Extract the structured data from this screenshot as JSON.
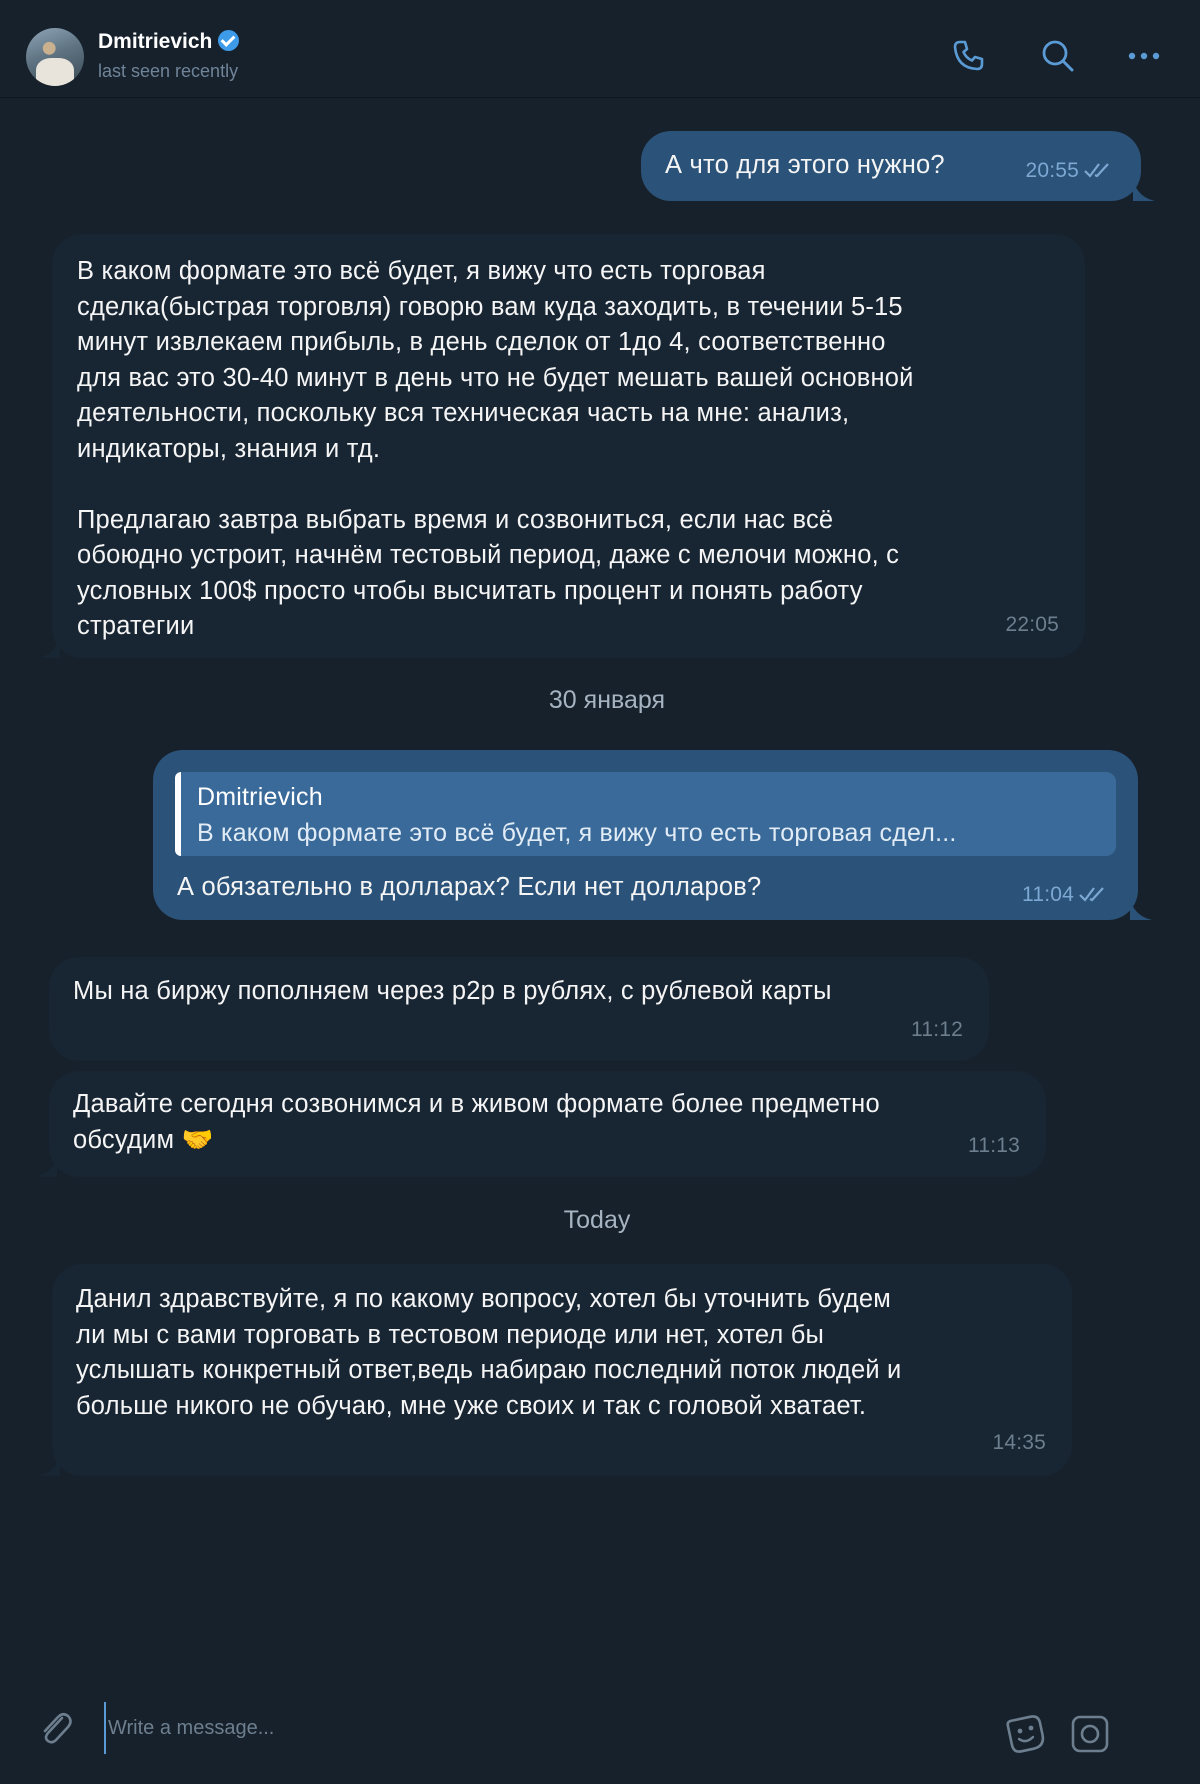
{
  "header": {
    "name": "Dmitrievich",
    "status": "last seen recently",
    "icons": [
      "phone-icon",
      "search-icon",
      "more-icon"
    ]
  },
  "messages": [
    {
      "text": "А что для этого нужно?",
      "time": "20:55"
    },
    {
      "text": "В каком формате это всё будет, я вижу что есть торговая\nсделка(быстрая торговля) говорю вам куда заходить, в течении 5-15\nминут извлекаем прибыль, в день сделок от 1до 4, соответственно\nдля вас это 30-40 минут в день что не будет мешать вашей основной\nдеятельности, поскольку вся техническая часть на мне: анализ,\nиндикаторы, знания и тд.\n\nПредлагаю завтра выбрать время и созвониться, если нас всё\nобоюдно устроит, начнём тестовый период, даже с мелочи можно, с\nусловных 100$ просто чтобы высчитать процент и понять работу\nстратегии",
      "time": "22:05"
    },
    {
      "reply_author": "Dmitrievich",
      "reply_text": "В каком формате это всё будет, я вижу что есть торговая сдел...",
      "text": "А обязательно в долларах? Если нет долларов?",
      "time": "11:04"
    },
    {
      "text": "Мы на биржу пополняем через p2p в рублях, с рублевой карты",
      "time": "11:12"
    },
    {
      "text": "Давайте сегодня созвонимся и в живом формате более предметно\nобсудим 🤝",
      "time": "11:13"
    },
    {
      "text": "Данил здравствуйте, я по какому вопросу, хотел бы уточнить будем\nли мы с вами торговать в тестовом периоде или нет, хотел бы\nуслышать конкретный ответ,ведь набираю последний поток людей и\nбольше никого не обучаю, мне уже своих и так с головой хватает.",
      "time": "14:35"
    }
  ],
  "date_separators": [
    "30 января",
    "Today"
  ],
  "composer": {
    "placeholder": "Write a message...",
    "icons": [
      "attach-icon",
      "sticker-icon",
      "camera-icon"
    ]
  },
  "colors": {
    "background": "#17212b",
    "incoming_bubble": "#182533",
    "outgoing_bubble": "#2b5278",
    "accent": "#5b9bd5"
  }
}
